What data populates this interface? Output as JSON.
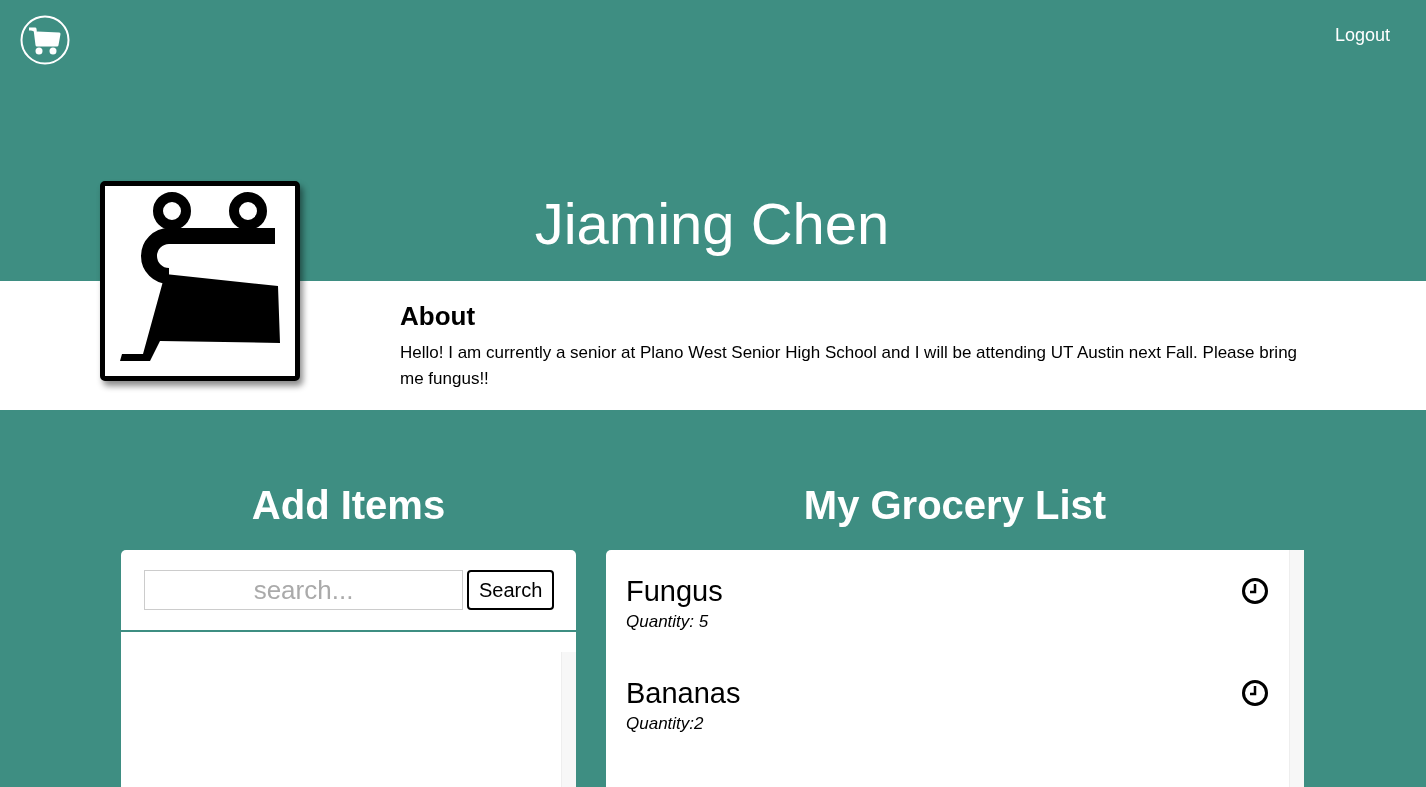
{
  "nav": {
    "logout": "Logout"
  },
  "profile": {
    "name": "Jiaming Chen",
    "about_title": "About",
    "about_text": "Hello! I am currently a senior at Plano West Senior High School and I will be attending UT Austin next Fall. Please bring me fungus!!"
  },
  "add_items": {
    "title": "Add Items",
    "search": {
      "placeholder": "search..."
    },
    "button": "Search"
  },
  "grocery_list": {
    "title": "My Grocery List",
    "items": [
      {
        "name": "Fungus",
        "quantity": "Quantity: 5"
      },
      {
        "name": "Bananas",
        "quantity": "Quantity:2"
      }
    ]
  }
}
